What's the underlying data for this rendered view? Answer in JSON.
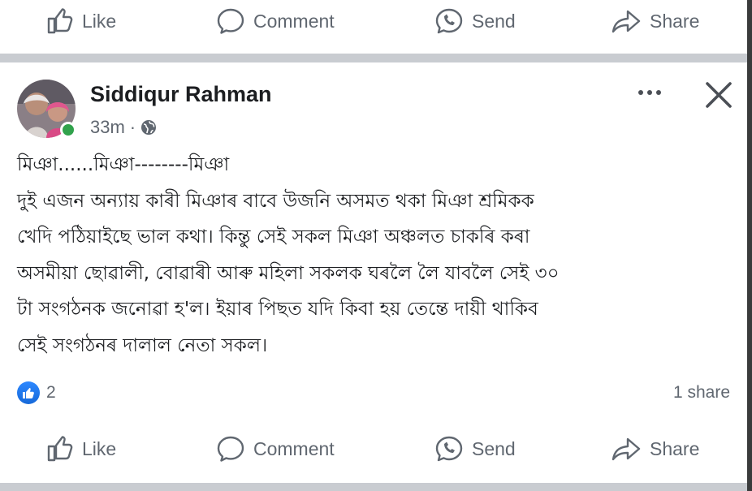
{
  "top_actions": {
    "like": "Like",
    "comment": "Comment",
    "send": "Send",
    "share": "Share"
  },
  "post": {
    "author": "Siddiqur Rahman",
    "time": "33m",
    "separator": "·",
    "body_lines": [
      "মিঞা......মিঞা--------মিঞা",
      "দুই এজন অন্যায় কাৰী মিঞাৰ বাবে উজনি অসমত থকা মিঞা শ্ৰমিকক",
      "খেদি পঠিয়াইছে ভাল কথা। কিন্তু সেই সকল মিঞা অঞ্চলত চাকৰি কৰা",
      "অসমীয়া ছোৱালী, বোৱাৰী আৰু মহিলা সকলক ঘৰলৈ লৈ যাবলৈ সেই ৩০",
      "টা সংগঠনক জনোৱা হ'ল। ইয়াৰ পিছত যদি কিবা হয় তেন্তে দায়ী থাকিব",
      "সেই সংগঠনৰ দালাল নেতা সকল।"
    ],
    "reaction_count": "2",
    "share_count": "1 share"
  },
  "bottom_actions": {
    "like": "Like",
    "comment": "Comment",
    "send": "Send",
    "share": "Share"
  },
  "colors": {
    "text": "#1c1e21",
    "muted": "#606770",
    "like_blue": "#1877f2",
    "online": "#31a24c",
    "separator": "#c9ccd1"
  },
  "icons": [
    "like-icon",
    "comment-icon",
    "send-icon",
    "share-icon",
    "globe-icon",
    "more-icon",
    "close-icon"
  ]
}
